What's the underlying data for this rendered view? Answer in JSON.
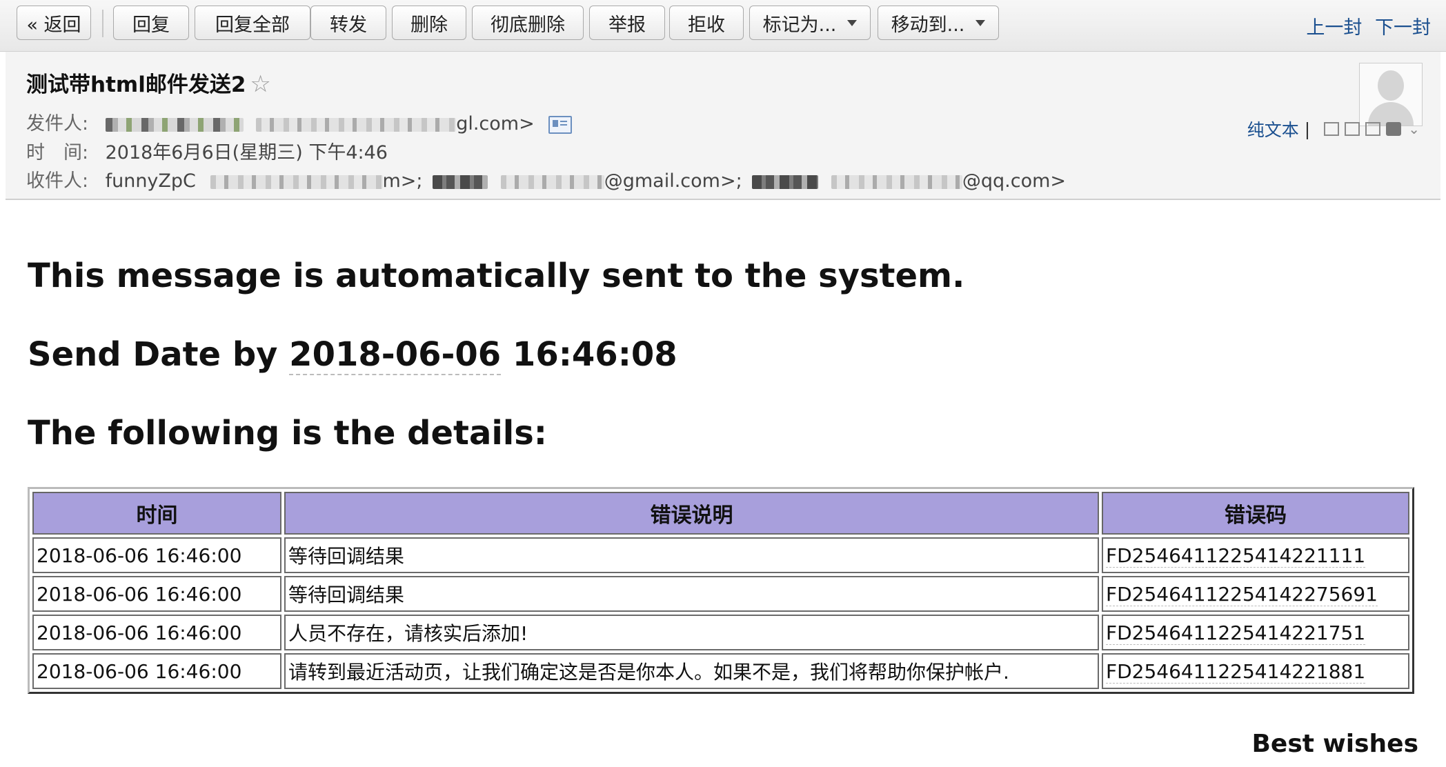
{
  "toolbar": {
    "back": "« 返回",
    "reply": "回复",
    "reply_all": "回复全部",
    "forward": "转发",
    "delete": "删除",
    "perm_delete": "彻底删除",
    "report": "举报",
    "reject": "拒收",
    "mark_as": "标记为...",
    "move_to": "移动到...",
    "prev": "上一封",
    "next": "下一封"
  },
  "header": {
    "subject": "测试带html邮件发送2",
    "from_label": "发件人:",
    "from_visible_suffix": "gl.com>",
    "time_label": "时　间:",
    "time_value": "2018年6月6日(星期三) 下午4:46",
    "to_label": "收件人:",
    "to_name": "funnyZpC",
    "to_part1": "m>;",
    "to_part2": "@gmail.com>;",
    "to_part3": "@qq.com>",
    "plain_text": "纯文本",
    "divider": "|"
  },
  "body": {
    "line1": "This message is automatically sent to the system.",
    "line2_prefix": "Send Date by ",
    "line2_date": "2018-06-06",
    "line2_time": " 16:46:08",
    "line3": "The following is the details:",
    "closing": "Best wishes"
  },
  "table": {
    "headers": [
      "时间",
      "错误说明",
      "错误码"
    ],
    "rows": [
      [
        "2018-06-06 16:46:00",
        "等待回调结果",
        "FD2546411225414221111"
      ],
      [
        "2018-06-06 16:46:00",
        "等待回调结果",
        "FD25464112254142275691"
      ],
      [
        "2018-06-06 16:46:00",
        "人员不存在，请核实后添加!",
        "FD2546411225414221751"
      ],
      [
        "2018-06-06 16:46:00",
        "请转到最近活动页，让我们确定这是否是你本人。如果不是，我们将帮助你保护帐户.",
        "FD2546411225414221881"
      ]
    ]
  },
  "colors": {
    "table_header_bg": "#a89fdc",
    "link": "#1a4f8f"
  }
}
